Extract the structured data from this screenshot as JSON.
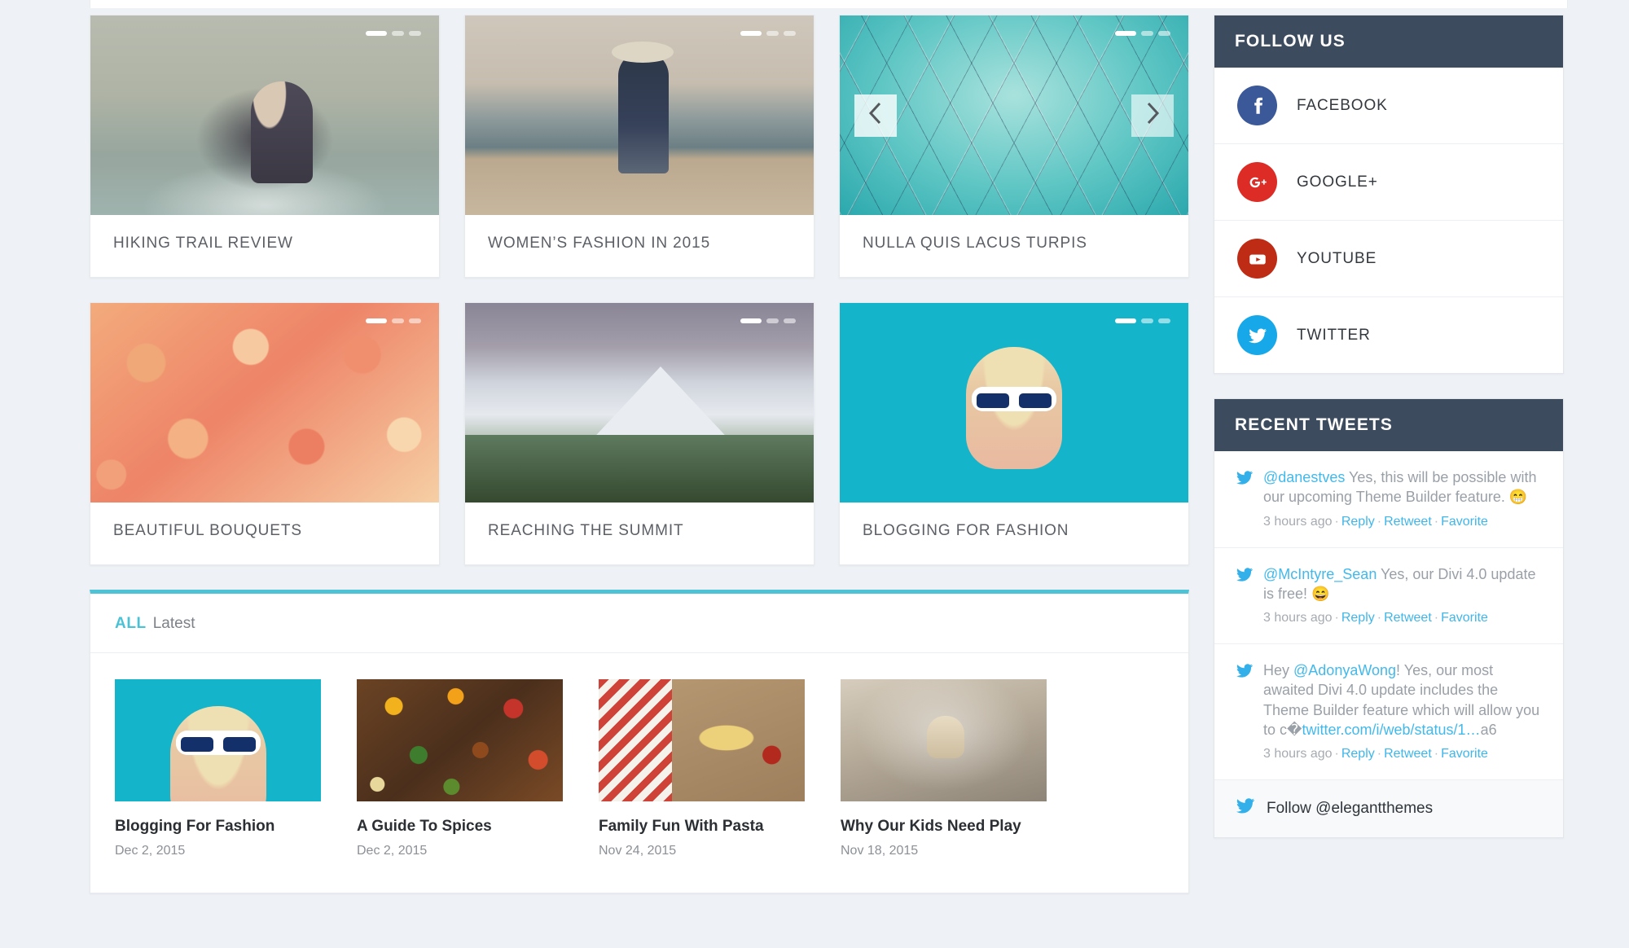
{
  "featured_cards": [
    {
      "title": "HIKING TRAIL REVIEW",
      "image": "hiking-couple-photo",
      "dots": 3,
      "active_dot": 0,
      "has_arrows": false
    },
    {
      "title": "WOMEN’S FASHION IN 2015",
      "image": "woman-pier-photo",
      "dots": 3,
      "active_dot": 0,
      "has_arrows": false
    },
    {
      "title": "NULLA QUIS LACUS TURPIS",
      "image": "agave-plant-photo",
      "dots": 3,
      "active_dot": 0,
      "has_arrows": true
    },
    {
      "title": "BEAUTIFUL BOUQUETS",
      "image": "roses-bouquet-photo",
      "dots": 3,
      "active_dot": 0,
      "has_arrows": false
    },
    {
      "title": "REACHING THE SUMMIT",
      "image": "half-dome-mountain-photo",
      "dots": 3,
      "active_dot": 0,
      "has_arrows": false
    },
    {
      "title": "BLOGGING FOR FASHION",
      "image": "blonde-sunglasses-photo",
      "dots": 3,
      "active_dot": 0,
      "has_arrows": false
    }
  ],
  "latest_panel": {
    "tab_all": "ALL",
    "tab_latest": "Latest",
    "accent_color": "#4ec3d6",
    "posts": [
      {
        "title": "Blogging For Fashion",
        "date": "Dec 2, 2015",
        "image": "blonde-sunglasses-thumb"
      },
      {
        "title": "A Guide To Spices",
        "date": "Dec 2, 2015",
        "image": "spices-bowls-thumb"
      },
      {
        "title": "Family Fun With Pasta",
        "date": "Nov 24, 2015",
        "image": "pasta-table-thumb"
      },
      {
        "title": "Why Our Kids Need Play",
        "date": "Nov 18, 2015",
        "image": "kid-airplane-thumb"
      }
    ]
  },
  "sidebar": {
    "follow_us": {
      "title": "FOLLOW US",
      "items": [
        {
          "label": "FACEBOOK",
          "icon": "facebook-icon",
          "color": "#3b5998"
        },
        {
          "label": "GOOGLE+",
          "icon": "google-plus-icon",
          "color": "#dd2c26"
        },
        {
          "label": "YOUTUBE",
          "icon": "youtube-icon",
          "color": "#bf2c16"
        },
        {
          "label": "TWITTER",
          "icon": "twitter-icon",
          "color": "#16a8e8"
        }
      ]
    },
    "recent_tweets": {
      "title": "RECENT TWEETS",
      "tweets": [
        {
          "handle": "@danestves",
          "text": " Yes, this will be possible with our upcoming Theme Builder feature. 😁",
          "prefix": "",
          "time": "3 hours ago",
          "reply": "Reply",
          "retweet": "Retweet",
          "favorite": "Favorite"
        },
        {
          "handle": "@McIntyre_Sean",
          "text": " Yes, our Divi 4.0 update is free! 😄",
          "prefix": "",
          "time": "3 hours ago",
          "reply": "Reply",
          "retweet": "Retweet",
          "favorite": "Favorite"
        },
        {
          "handle": "@AdonyaWong",
          "prefix": "Hey ",
          "text": "! Yes, our most awaited Divi 4.0 update includes the Theme Builder feature which will allow you to c�",
          "link": "twitter.com/i/web/status/1…",
          "tail": "a6",
          "time": "3 hours ago",
          "reply": "Reply",
          "retweet": "Retweet",
          "favorite": "Favorite"
        }
      ],
      "follow_link": "Follow @elegantthemes"
    }
  }
}
